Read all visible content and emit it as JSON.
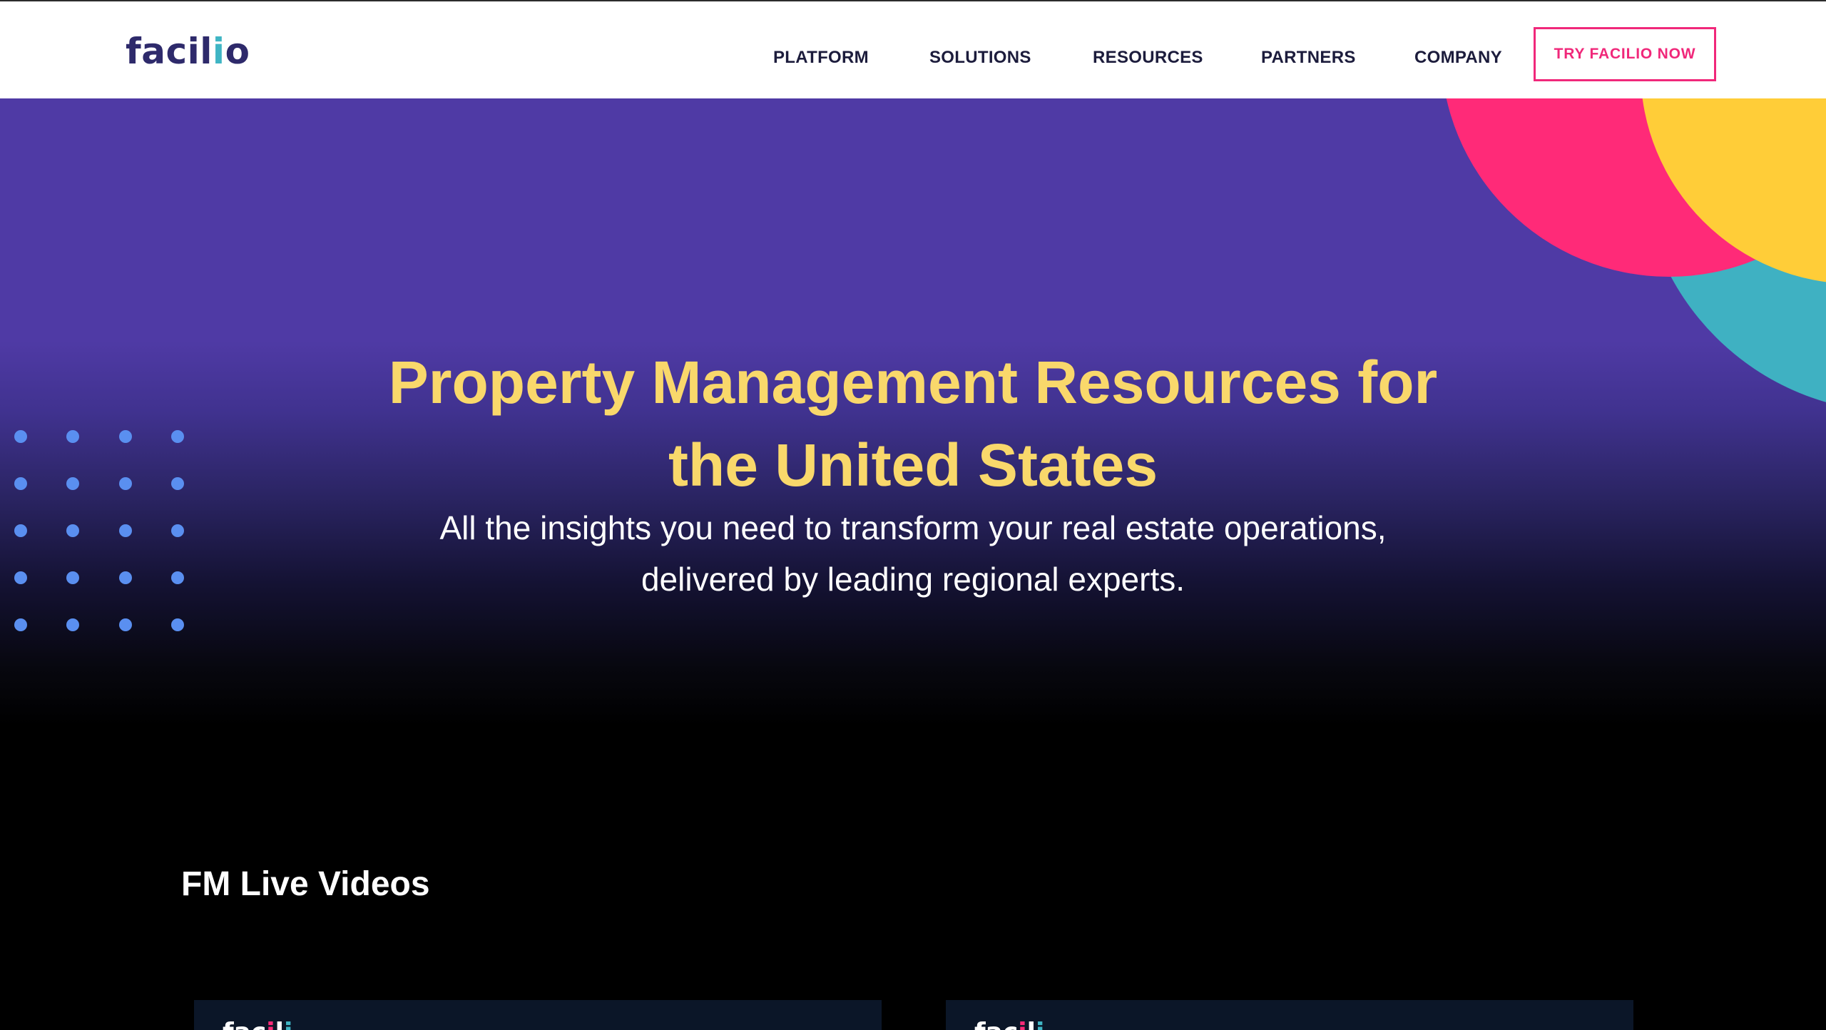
{
  "header": {
    "logo": {
      "text_prefix": "facil",
      "text_accent": "i",
      "text_suffix": "o"
    },
    "nav": [
      {
        "label": "PLATFORM"
      },
      {
        "label": "SOLUTIONS"
      },
      {
        "label": "RESOURCES"
      },
      {
        "label": "PARTNERS"
      },
      {
        "label": "COMPANY"
      }
    ],
    "cta_label": "TRY FACILIO NOW"
  },
  "hero": {
    "title_line1": "Property Management Resources for",
    "title_line2": "the United States",
    "subtitle_line1": "All the insights you need to transform your real estate operations,",
    "subtitle_line2": "delivered by leading regional experts."
  },
  "section": {
    "title": "FM Live Videos",
    "cards": [
      {
        "logo_prefix": "fac",
        "logo_accent1": "i",
        "logo_mid": "l",
        "logo_accent2": "i"
      },
      {
        "logo_prefix": "fac",
        "logo_accent1": "i",
        "logo_mid": "l",
        "logo_accent2": "i"
      }
    ]
  },
  "colors": {
    "brand_navy": "#2e2a6b",
    "accent_pink": "#f0287a",
    "hero_purple": "#4f3aa5",
    "title_yellow": "#f9d86b",
    "circle_pink": "#ff2a78",
    "circle_yellow": "#ffcd38",
    "circle_teal": "#3fb1c2",
    "dot_blue": "#5a8ff0"
  }
}
